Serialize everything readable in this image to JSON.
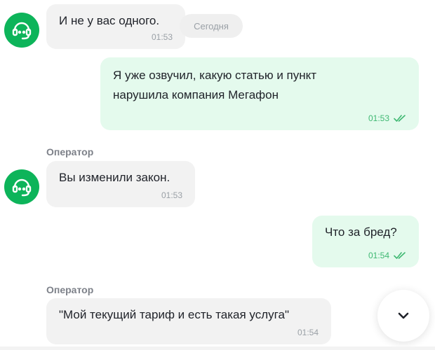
{
  "day_separator": "Сегодня",
  "messages": [
    {
      "from": "operator",
      "text": "И не у вас одного.",
      "time": "01:53"
    },
    {
      "from": "user",
      "text": "Я уже озвучил, какую статью и пункт\nнарушила компания Мегафон",
      "time": "01:53",
      "status": "read"
    },
    {
      "from": "operator",
      "sender": "Оператор",
      "text": "Вы изменили закон.",
      "time": "01:53"
    },
    {
      "from": "user",
      "text": "Что за бред?",
      "time": "01:54",
      "status": "read"
    },
    {
      "from": "operator",
      "sender": "Оператор",
      "text": "\"Мой текущий тариф и есть такая услуга\"",
      "time": "01:54"
    }
  ],
  "colors": {
    "avatar": "#0db45a",
    "user_bubble": "#e4faed",
    "operator_bubble": "#f2f2f2",
    "accent": "#3fb872"
  },
  "icons": {
    "avatar": "headset-icon",
    "read": "double-check-icon",
    "scroll": "chevron-down-icon"
  }
}
